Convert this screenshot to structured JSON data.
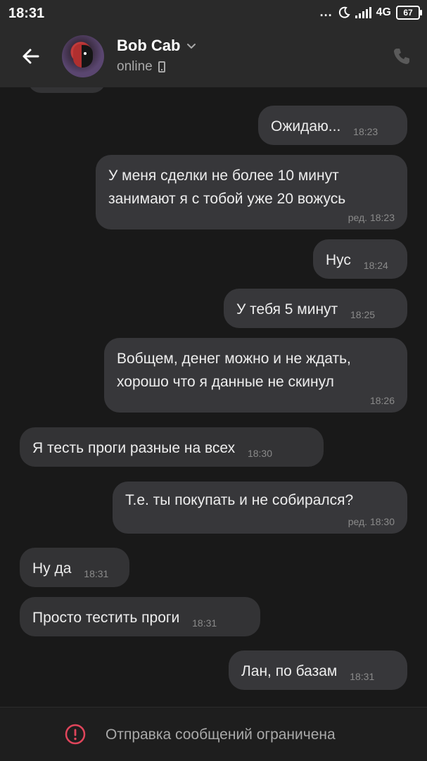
{
  "status_bar": {
    "time": "18:31",
    "dots": "...",
    "network": "4G",
    "battery": "67"
  },
  "header": {
    "contact_name": "Bob Cab",
    "status": "online",
    "icons": {
      "back": "arrow-left-icon",
      "dropdown": "chevron-down-icon",
      "device": "mobile-phone-icon",
      "call": "phone-call-icon"
    }
  },
  "messages": [
    {
      "direction": "out",
      "text": "Ожидаю...",
      "time": "18:23"
    },
    {
      "direction": "out",
      "text": "У меня сделки не более 10 минут\nзанимают я с тобой уже 20 вожусь",
      "time": "ред. 18:23"
    },
    {
      "direction": "out",
      "text": "Нус",
      "time": "18:24"
    },
    {
      "direction": "out",
      "text": "У тебя 5 минут",
      "time": "18:25"
    },
    {
      "direction": "out",
      "text": "Вобщем, денег можно и не ждать,\nхорошо что я данные не скинул",
      "time": "18:26"
    },
    {
      "direction": "in",
      "text": "Я тесть проги разные на всех",
      "time": "18:30"
    },
    {
      "direction": "out",
      "text": "Т.е. ты покупать и не собирался?",
      "time": "ред. 18:30"
    },
    {
      "direction": "in",
      "text": "Ну да",
      "time": "18:31"
    },
    {
      "direction": "in",
      "text": "Просто тестить проги",
      "time": "18:31"
    },
    {
      "direction": "out",
      "text": "Лан, по базам",
      "time": "18:31"
    }
  ],
  "footer": {
    "text": "Отправка сообщений ограничена",
    "icon": "warning-circle-icon",
    "accent_color": "#e0455b"
  },
  "colors": {
    "background": "#191919",
    "header": "#2a2a2a",
    "bubble": "#37373a"
  }
}
